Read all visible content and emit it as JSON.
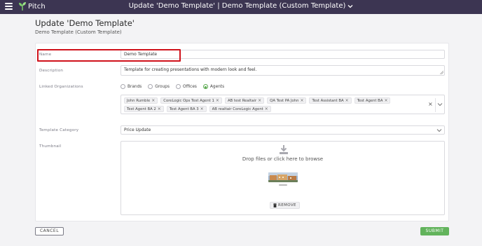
{
  "header": {
    "app_name": "Pitch",
    "window_title": "Update 'Demo Template' | Demo Template (Custom Template)",
    "menu_icon": "hamburger-menu-icon",
    "logo_icon": "sprout-icon",
    "bg_color": "#3c3552"
  },
  "page": {
    "title": "Update 'Demo Template'",
    "subtitle": "Demo Template (Custom Template)"
  },
  "form": {
    "name": {
      "label": "Name",
      "value": "Demo Template"
    },
    "description": {
      "label": "Description",
      "value": "Template for creating presentations with modern look and feel."
    },
    "linked_orgs": {
      "label": "Linked Organizations",
      "options": [
        {
          "label": "Brands",
          "checked": false
        },
        {
          "label": "Groups",
          "checked": false
        },
        {
          "label": "Offices",
          "checked": false
        },
        {
          "label": "Agents",
          "checked": true
        }
      ],
      "selected": [
        "John Rumble",
        "CoreLogic Ops Test Agent 1",
        "AB test Realtair",
        "QA Test PA John",
        "Test Assistant BA",
        "Test Agent BA",
        "Test Agent BA 2",
        "Test Agent BA 3",
        "AB realtair CoreLogic Agent"
      ],
      "clear_glyph": "×",
      "chip_remove_glyph": "×"
    },
    "category": {
      "label": "Template Category",
      "value": "Price Update"
    },
    "thumbnail": {
      "label": "Thumbnail",
      "dropzone_text": "Drop files or click here to browse",
      "upload_icon": "download-arrow-icon",
      "remove_label": "REMOVE"
    }
  },
  "actions": {
    "cancel_label": "CANCEL",
    "submit_label": "SUBMIT",
    "submit_color": "#62b35c"
  },
  "highlight_color": "#d0121b"
}
